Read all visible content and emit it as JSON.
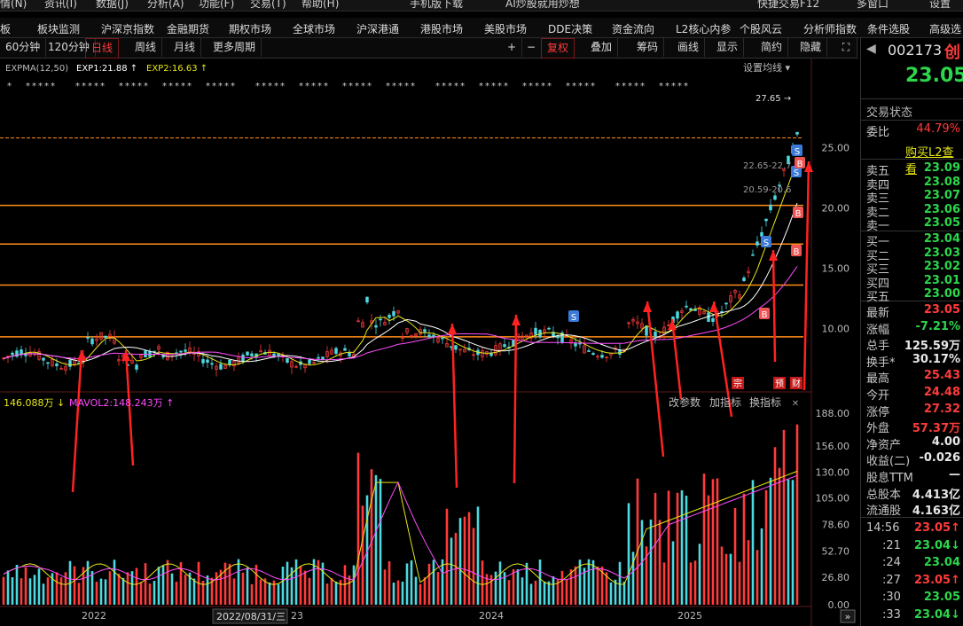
{
  "top_strip": [
    "情(N)",
    "资讯(I)",
    "数据(J)",
    "分析(A)",
    "功能(F)",
    "交易(T)",
    "帮助(H)",
    "手机版下载",
    "AI炒股就用炒想",
    "快捷交易F12",
    "多窗口",
    "设置"
  ],
  "menu": [
    "板",
    "板块监测",
    "沪深京指数",
    "金融期货",
    "期权市场",
    "全球市场",
    "沪深港通",
    "港股市场",
    "美股市场",
    "DDE决策",
    "资金流向",
    "L2核心内参",
    "个股风云",
    "分析师指数",
    "条件选股",
    "高级选"
  ],
  "toolbar": {
    "periods": [
      "60分钟",
      "120分钟",
      "日线",
      "周线",
      "月线",
      "更多周期"
    ],
    "active_period": "日线",
    "right_tools": [
      "复权",
      "叠加",
      "筹码",
      "画线",
      "显示",
      "简约",
      "隐藏"
    ]
  },
  "indicator_top": {
    "name": "EXPMA(12,50)",
    "exp1": "EXP1:21.88",
    "exp2": "EXP2:16.63",
    "setting": "设置均线"
  },
  "price_labels": {
    "high_mark": "27.65",
    "level1": "22.65-22.7",
    "level2": "20.59-20.6"
  },
  "y_axis_price": [
    "25.00",
    "20.00",
    "15.00",
    "10.00"
  ],
  "badges": [
    "宗",
    "预",
    "财"
  ],
  "volume": {
    "mavol1": "146.088万",
    "mavol2": "MAVOL2:148.243万",
    "buttons": [
      "改参数",
      "加指标",
      "换指标"
    ]
  },
  "y_axis_vol": [
    "188.00",
    "156.00",
    "130.00",
    "105.00",
    "78.60",
    "52.70",
    "26.80",
    "0.00"
  ],
  "x_axis": [
    "2022",
    "2022/08/31/三",
    "23",
    "2024",
    "2025"
  ],
  "right_panel": {
    "code": "002173",
    "name_partial": "创",
    "price": "23.05",
    "status_title": "交易状态",
    "weibi_label": "委比",
    "weibi": "44.79%",
    "buy_l2": "购买L2查看",
    "asks": [
      {
        "l": "卖五",
        "v": "23.09"
      },
      {
        "l": "卖四",
        "v": "23.08"
      },
      {
        "l": "卖三",
        "v": "23.07"
      },
      {
        "l": "卖二",
        "v": "23.06"
      },
      {
        "l": "卖一",
        "v": "23.05"
      }
    ],
    "bids": [
      {
        "l": "买一",
        "v": "23.04"
      },
      {
        "l": "买二",
        "v": "23.03"
      },
      {
        "l": "买三",
        "v": "23.02"
      },
      {
        "l": "买四",
        "v": "23.01"
      },
      {
        "l": "买五",
        "v": "23.00"
      }
    ],
    "stats": [
      {
        "l": "最新",
        "v": "23.05",
        "c": "#ff3b3b"
      },
      {
        "l": "涨幅",
        "v": "-7.21%",
        "c": "#2dd64b"
      },
      {
        "l": "总手",
        "v": "125.59万",
        "c": "#e8e8e8"
      },
      {
        "l": "换手*",
        "v": "30.17%",
        "c": "#e8e8e8"
      },
      {
        "l": "最高",
        "v": "25.43",
        "c": "#ff3b3b"
      },
      {
        "l": "今开",
        "v": "24.48",
        "c": "#ff3b3b"
      },
      {
        "l": "涨停",
        "v": "27.32",
        "c": "#ff3b3b"
      },
      {
        "l": "外盘",
        "v": "57.37万",
        "c": "#ff3b3b"
      },
      {
        "l": "净资产",
        "v": "4.00",
        "c": "#e8e8e8"
      },
      {
        "l": "收益(二)",
        "v": "-0.026",
        "c": "#e8e8e8"
      },
      {
        "l": "股息TTM",
        "v": "—",
        "c": "#e8e8e8"
      },
      {
        "l": "总股本",
        "v": "4.413亿",
        "c": "#e8e8e8"
      },
      {
        "l": "流通股",
        "v": "4.163亿",
        "c": "#e8e8e8"
      }
    ],
    "ticks": [
      {
        "t": "14:56",
        "p": "23.05",
        "a": "↑",
        "c": "#ff3b3b"
      },
      {
        "t": ":21",
        "p": "23.04",
        "a": "↓",
        "c": "#2dd64b"
      },
      {
        "t": ":24",
        "p": "23.04",
        "a": "",
        "c": "#2dd64b"
      },
      {
        "t": ":27",
        "p": "23.05",
        "a": "↑",
        "c": "#ff3b3b"
      },
      {
        "t": ":30",
        "p": "23.05",
        "a": "",
        "c": "#2dd64b"
      },
      {
        "t": ":33",
        "p": "23.04",
        "a": "↓",
        "c": "#2dd64b"
      }
    ]
  },
  "colors": {
    "up": "#ff3b3b",
    "down": "#2dd64b",
    "cyan": "#4ed8e0",
    "orange": "#ff8c1a",
    "yellow": "#e6e61a",
    "magenta": "#ff4cff"
  }
}
